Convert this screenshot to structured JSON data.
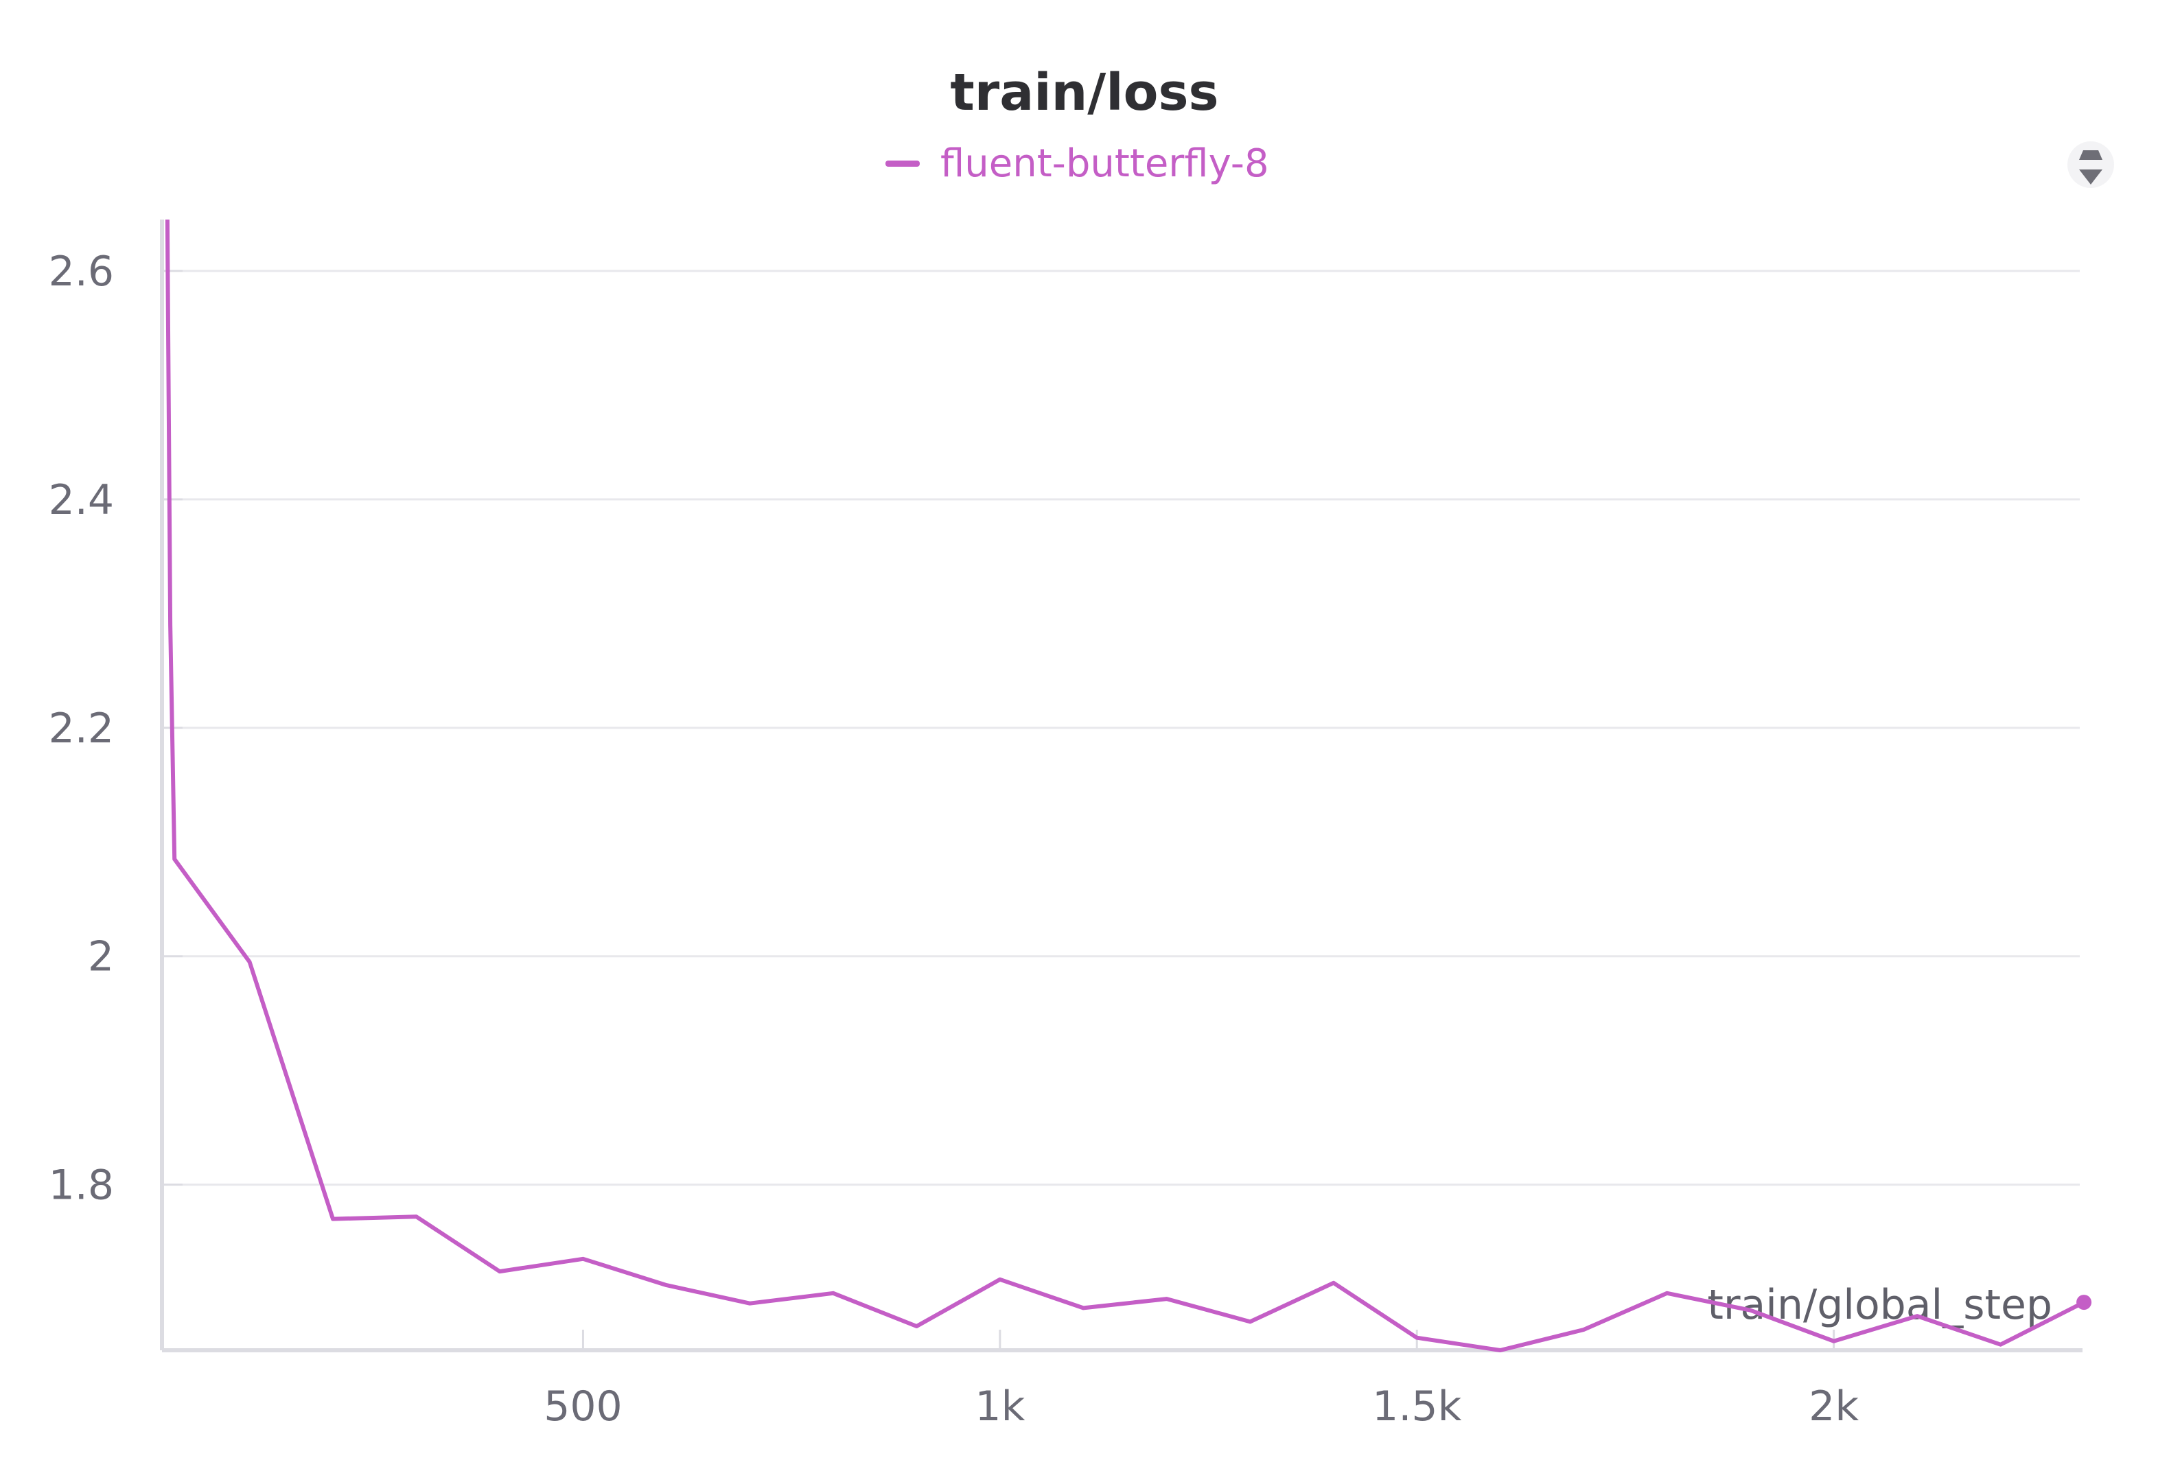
{
  "chart_data": {
    "type": "line",
    "title": "train/loss",
    "xlabel": "train/global_step",
    "ylabel": "",
    "xlim": [
      -5,
      2295
    ],
    "ylim": [
      1.655,
      2.645
    ],
    "x_ticks": [
      500,
      1000,
      1500,
      2000
    ],
    "x_tick_labels": [
      "500",
      "1k",
      "1.5k",
      "2k"
    ],
    "y_ticks": [
      1.8,
      2.0,
      2.2,
      2.4,
      2.6
    ],
    "y_tick_labels": [
      "1.8",
      "2",
      "2.2",
      "2.4",
      "2.6"
    ],
    "grid": true,
    "legend_position": "top-center",
    "series": [
      {
        "name": "fluent-butterfly-8",
        "color": "#c45ec6",
        "x": [
          0,
          2,
          5,
          10,
          100,
          200,
          300,
          400,
          500,
          600,
          700,
          800,
          900,
          1000,
          1100,
          1200,
          1300,
          1400,
          1500,
          1600,
          1700,
          1800,
          1900,
          2000,
          2100,
          2200,
          2300
        ],
        "y": [
          2.8,
          2.59,
          2.29,
          2.085,
          1.995,
          1.77,
          1.772,
          1.724,
          1.735,
          1.712,
          1.696,
          1.705,
          1.676,
          1.717,
          1.692,
          1.7,
          1.68,
          1.714,
          1.666,
          1.655,
          1.673,
          1.705,
          1.69,
          1.663,
          1.685,
          1.66,
          1.697
        ]
      }
    ]
  },
  "legend": {
    "series_name": "fluent-butterfly-8",
    "color": "#c45ec6"
  },
  "ui": {
    "menu_icon": "drag-handle-icon"
  }
}
